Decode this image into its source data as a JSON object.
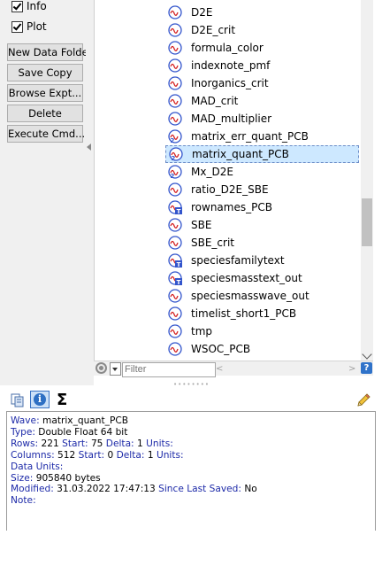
{
  "sidebar": {
    "checkboxes": [
      {
        "label": "Info",
        "checked": true
      },
      {
        "label": "Plot",
        "checked": true
      }
    ],
    "buttons": [
      "New Data Folder",
      "Save Copy",
      "Browse Expt...",
      "Delete",
      "Execute Cmd..."
    ]
  },
  "list": {
    "items": [
      {
        "label": "D2E",
        "icon": "wave-icon"
      },
      {
        "label": "D2E_crit",
        "icon": "wave-icon"
      },
      {
        "label": "formula_color",
        "icon": "wave-icon"
      },
      {
        "label": "indexnote_pmf",
        "icon": "wave-icon"
      },
      {
        "label": "Inorganics_crit",
        "icon": "wave-icon"
      },
      {
        "label": "MAD_crit",
        "icon": "wave-icon"
      },
      {
        "label": "MAD_multiplier",
        "icon": "wave-icon"
      },
      {
        "label": "matrix_err_quant_PCB",
        "icon": "matrix-wave-icon"
      },
      {
        "label": "matrix_quant_PCB",
        "icon": "matrix-wave-icon",
        "selected": true
      },
      {
        "label": "Mx_D2E",
        "icon": "matrix-wave-icon"
      },
      {
        "label": "ratio_D2E_SBE",
        "icon": "wave-icon"
      },
      {
        "label": "rownames_PCB",
        "icon": "text-wave-icon"
      },
      {
        "label": "SBE",
        "icon": "wave-icon"
      },
      {
        "label": "SBE_crit",
        "icon": "wave-icon"
      },
      {
        "label": "speciesfamilytext",
        "icon": "text-wave-icon"
      },
      {
        "label": "speciesmasstext_out",
        "icon": "text-wave-icon"
      },
      {
        "label": "speciesmasswave_out",
        "icon": "wave-icon"
      },
      {
        "label": "timelist_short1_PCB",
        "icon": "wave-icon"
      },
      {
        "label": "tmp",
        "icon": "wave-icon"
      },
      {
        "label": "WSOC_PCB",
        "icon": "wave-icon"
      }
    ],
    "filter_placeholder": "Filter"
  },
  "toolbar": {
    "info_glyph": "i",
    "sigma_glyph": "Σ"
  },
  "info": {
    "wave_label": "Wave:",
    "wave_value": "matrix_quant_PCB",
    "type_label": "Type:",
    "type_value": "Double Float 64 bit",
    "rows_label": "Rows:",
    "rows_value": "221",
    "rows_start_label": "Start:",
    "rows_start_value": "75",
    "rows_delta_label": "Delta:",
    "rows_delta_value": "1",
    "rows_units_label": "Units:",
    "cols_label": "Columns:",
    "cols_value": "512",
    "cols_start_label": "Start:",
    "cols_start_value": "0",
    "cols_delta_label": "Delta:",
    "cols_delta_value": "1",
    "cols_units_label": "Units:",
    "data_units_label": "Data Units:",
    "size_label": "Size:",
    "size_value": "905840 bytes",
    "modified_label": "Modified:",
    "modified_value": "31.03.2022 17:47:13",
    "since_label": "Since Last Saved:",
    "since_value": "No",
    "note_label": "Note:"
  },
  "colors": {
    "label_blue": "#1d2aa8",
    "selection_bg": "#cde8ff",
    "wave_icon_blue": "#3355cc",
    "wave_icon_red": "#d42020"
  }
}
